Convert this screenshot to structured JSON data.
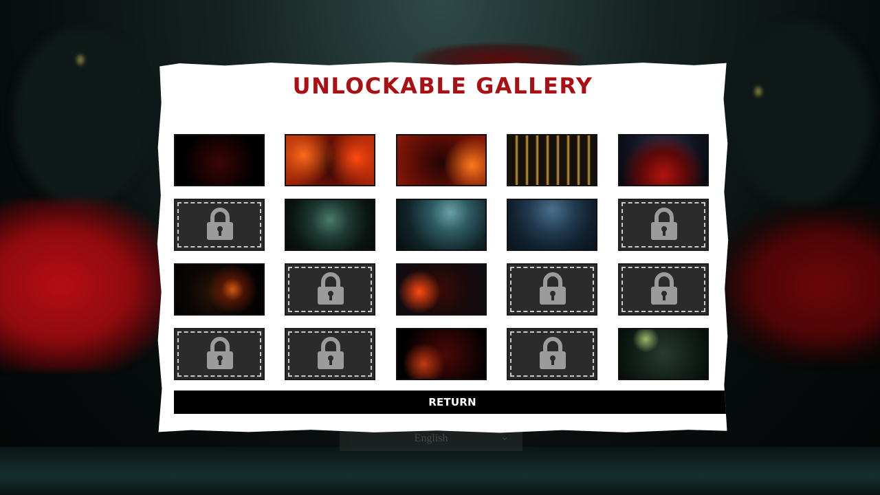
{
  "screen": {
    "title": "UNLOCKABLE GALLERY",
    "return_label": "RETURN"
  },
  "background": {
    "language_label": "English",
    "chevron_icon": "chevron-down-icon"
  },
  "colors": {
    "title": "#a90f13",
    "panel": "#ffffff",
    "return_button": "#000000",
    "locked_tile": "#2b2b2b",
    "lock_icon": "#9b9b9b"
  },
  "gallery": {
    "columns": 5,
    "rows": 4,
    "lock_icon": "padlock-icon",
    "tiles": [
      {
        "state": "unlocked",
        "image": "top-hat-demon-red-lightning"
      },
      {
        "state": "unlocked",
        "image": "top-hat-demon-fire"
      },
      {
        "state": "unlocked",
        "image": "top-hat-demon-flames"
      },
      {
        "state": "unlocked",
        "image": "golden-hall-corridor"
      },
      {
        "state": "unlocked",
        "image": "red-cathedral-night"
      },
      {
        "state": "locked"
      },
      {
        "state": "unlocked",
        "image": "dark-forest-path"
      },
      {
        "state": "unlocked",
        "image": "haunted-castle"
      },
      {
        "state": "unlocked",
        "image": "dark-river-night"
      },
      {
        "state": "locked"
      },
      {
        "state": "unlocked",
        "image": "shadow-figure-glow"
      },
      {
        "state": "locked"
      },
      {
        "state": "unlocked",
        "image": "top-hat-demon-embers"
      },
      {
        "state": "locked"
      },
      {
        "state": "locked"
      },
      {
        "state": "locked"
      },
      {
        "state": "locked"
      },
      {
        "state": "unlocked",
        "image": "demon-lantern"
      },
      {
        "state": "locked"
      },
      {
        "state": "unlocked",
        "image": "foggy-bridge-lamps"
      }
    ]
  }
}
